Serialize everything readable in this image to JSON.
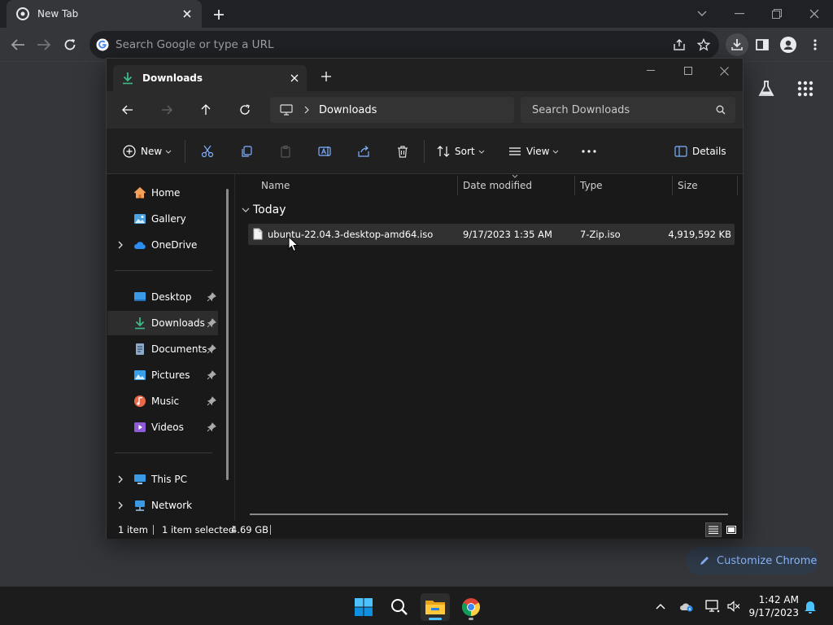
{
  "chrome": {
    "tab_title": "New Tab",
    "omnibox_placeholder": "Search Google or type a URL",
    "customize_label": "Customize Chrome"
  },
  "explorer": {
    "tab_title": "Downloads",
    "breadcrumb": "Downloads",
    "search_placeholder": "Search Downloads",
    "commands": {
      "new": "New",
      "sort": "Sort",
      "view": "View",
      "details": "Details"
    },
    "sidebar": {
      "quick": [
        {
          "label": "Home"
        },
        {
          "label": "Gallery"
        },
        {
          "label": "OneDrive"
        }
      ],
      "pinned": [
        {
          "label": "Desktop"
        },
        {
          "label": "Downloads"
        },
        {
          "label": "Documents"
        },
        {
          "label": "Pictures"
        },
        {
          "label": "Music"
        },
        {
          "label": "Videos"
        }
      ],
      "system": [
        {
          "label": "This PC"
        },
        {
          "label": "Network"
        }
      ]
    },
    "columns": {
      "name": "Name",
      "date": "Date modified",
      "type": "Type",
      "size": "Size"
    },
    "group_label": "Today",
    "files": [
      {
        "name": "ubuntu-22.04.3-desktop-amd64.iso",
        "date": "9/17/2023 1:35 AM",
        "type": "7-Zip.iso",
        "size": "4,919,592 KB"
      }
    ],
    "status": {
      "count": "1 item",
      "selected": "1 item selected",
      "size": "4.69 GB"
    }
  },
  "taskbar": {
    "time": "1:42 AM",
    "date": "9/17/2023"
  },
  "colors": {
    "accent_blue": "#0078d4",
    "chrome_link": "#8ab4f8",
    "download_green": "#3fb98a"
  }
}
